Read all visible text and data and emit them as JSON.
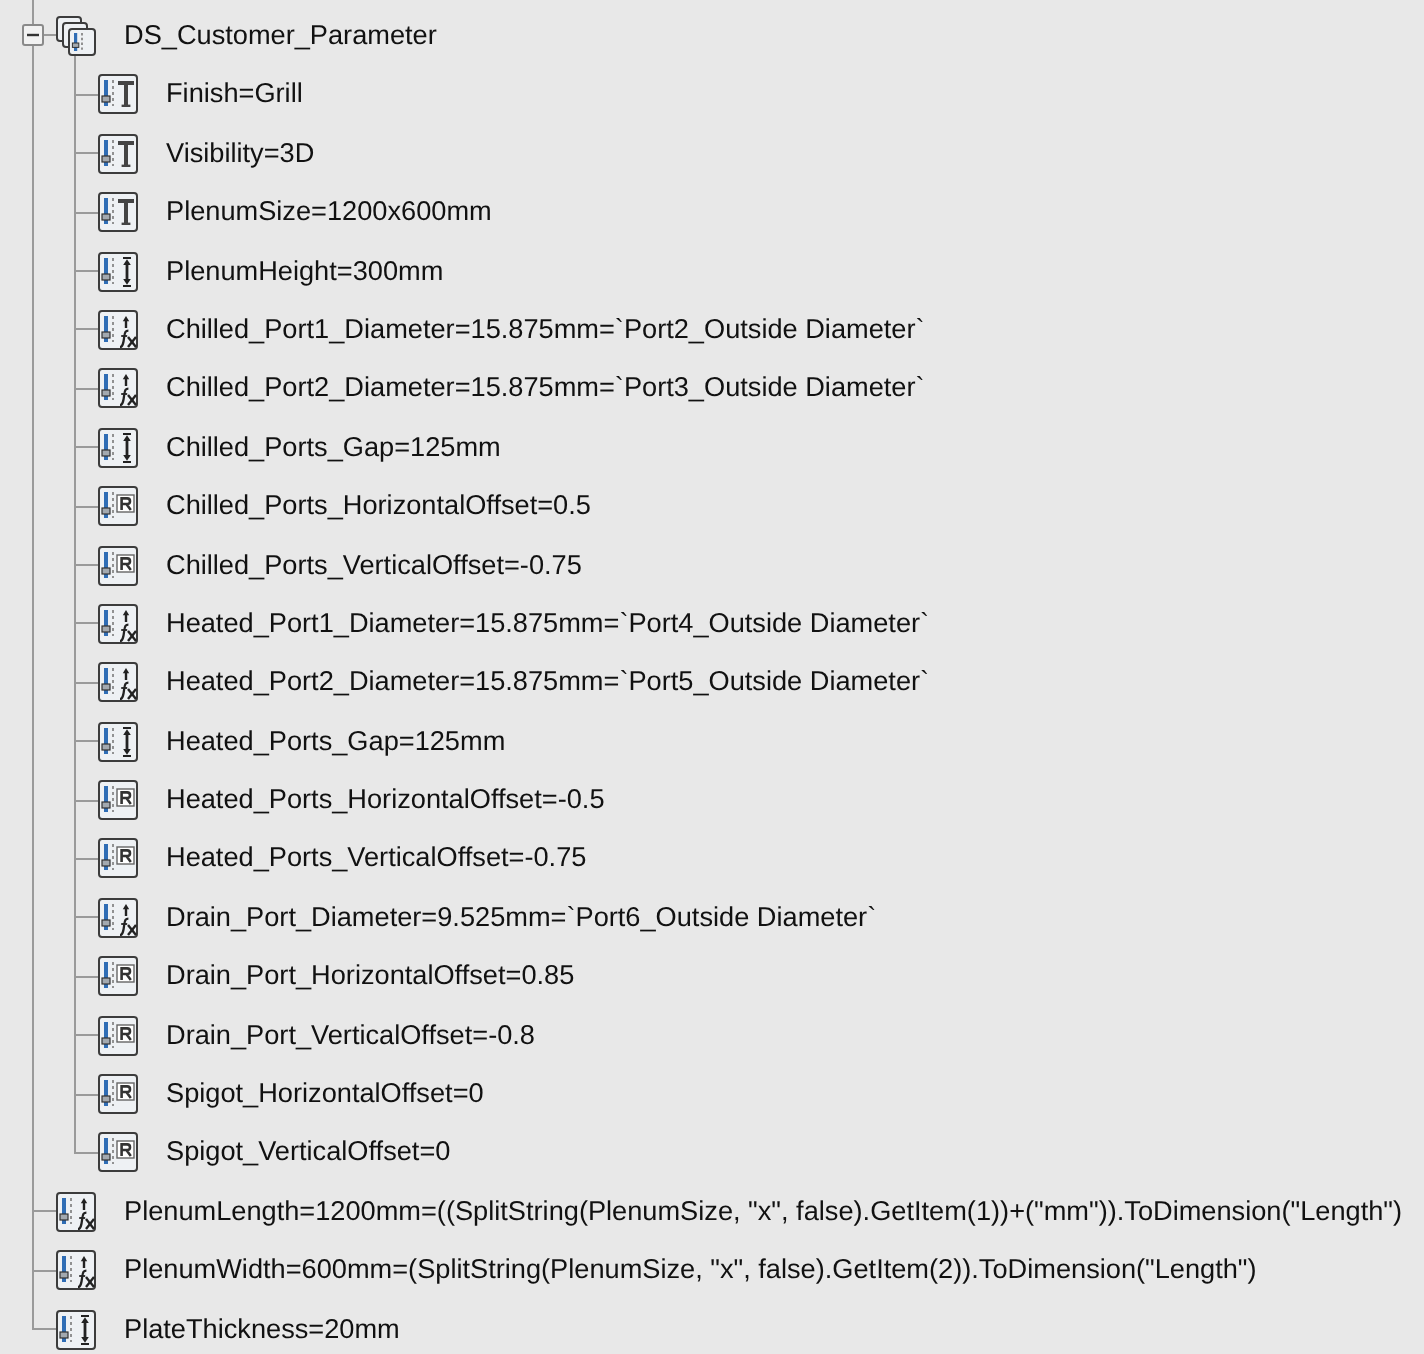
{
  "tree": {
    "items": [
      {
        "kind": "parameter-set",
        "label": "DS_Customer_Parameter",
        "expanded": true,
        "children": [
          {
            "kind": "text",
            "label": "Finish=Grill"
          },
          {
            "kind": "text",
            "label": "Visibility=3D"
          },
          {
            "kind": "text",
            "label": "PlenumSize=1200x600mm"
          },
          {
            "kind": "length",
            "label": "PlenumHeight=300mm"
          },
          {
            "kind": "formula",
            "label": "Chilled_Port1_Diameter=15.875mm=`Port2_Outside Diameter`"
          },
          {
            "kind": "formula",
            "label": "Chilled_Port2_Diameter=15.875mm=`Port3_Outside Diameter`"
          },
          {
            "kind": "length",
            "label": "Chilled_Ports_Gap=125mm"
          },
          {
            "kind": "real",
            "label": "Chilled_Ports_HorizontalOffset=0.5"
          },
          {
            "kind": "real",
            "label": "Chilled_Ports_VerticalOffset=-0.75"
          },
          {
            "kind": "formula",
            "label": "Heated_Port1_Diameter=15.875mm=`Port4_Outside Diameter`"
          },
          {
            "kind": "formula",
            "label": "Heated_Port2_Diameter=15.875mm=`Port5_Outside Diameter`"
          },
          {
            "kind": "length",
            "label": "Heated_Ports_Gap=125mm"
          },
          {
            "kind": "real",
            "label": "Heated_Ports_HorizontalOffset=-0.5"
          },
          {
            "kind": "real",
            "label": "Heated_Ports_VerticalOffset=-0.75"
          },
          {
            "kind": "formula",
            "label": "Drain_Port_Diameter=9.525mm=`Port6_Outside Diameter`"
          },
          {
            "kind": "real",
            "label": "Drain_Port_HorizontalOffset=0.85"
          },
          {
            "kind": "real",
            "label": "Drain_Port_VerticalOffset=-0.8"
          },
          {
            "kind": "real",
            "label": "Spigot_HorizontalOffset=0"
          },
          {
            "kind": "real",
            "label": "Spigot_VerticalOffset=0"
          }
        ]
      },
      {
        "kind": "formula",
        "label": "PlenumLength=1200mm=((SplitString(PlenumSize, \"x\", false).GetItem(1))+(\"mm\")).ToDimension(\"Length\")"
      },
      {
        "kind": "formula",
        "label": "PlenumWidth=600mm=(SplitString(PlenumSize, \"x\", false).GetItem(2)).ToDimension(\"Length\")"
      },
      {
        "kind": "length",
        "label": "PlateThickness=20mm"
      }
    ]
  }
}
